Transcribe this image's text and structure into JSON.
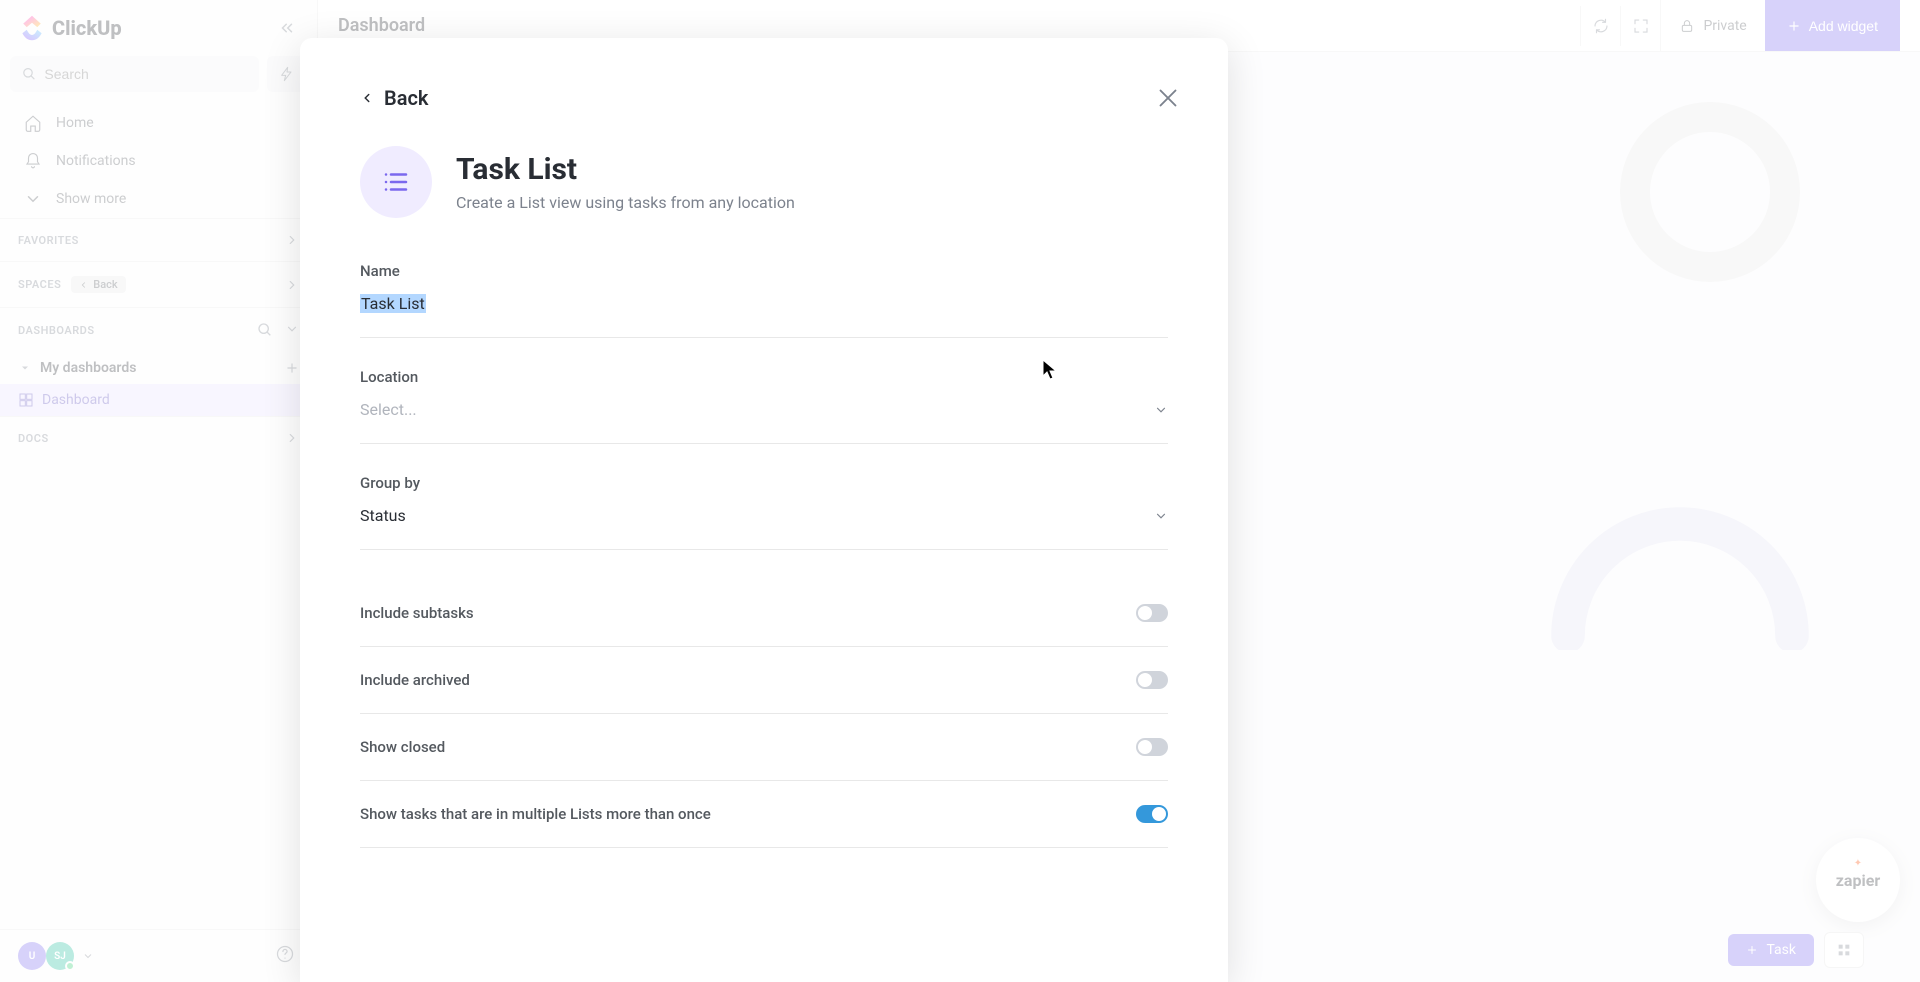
{
  "app": {
    "name": "ClickUp"
  },
  "sidebar": {
    "search_placeholder": "Search",
    "nav": {
      "home": "Home",
      "notifications": "Notifications",
      "show_more": "Show more"
    },
    "favorites_label": "FAVORITES",
    "spaces_label": "SPACES",
    "back_pill": "Back",
    "dashboards_label": "DASHBOARDS",
    "my_dashboards": "My dashboards",
    "dashboard_item": "Dashboard",
    "docs_label": "DOCS",
    "avatars": {
      "u": "U",
      "sj": "SJ"
    }
  },
  "topbar": {
    "title": "Dashboard",
    "private": "Private",
    "add_widget": "Add widget"
  },
  "modal": {
    "back": "Back",
    "title": "Task List",
    "description": "Create a List view using tasks from any location",
    "name_label": "Name",
    "name_value": "Task List",
    "location_label": "Location",
    "location_placeholder": "Select...",
    "groupby_label": "Group by",
    "groupby_value": "Status",
    "include_subtasks": "Include subtasks",
    "include_archived": "Include archived",
    "show_closed": "Show closed",
    "show_multi_lists": "Show tasks that are in multiple Lists more than once",
    "toggles": {
      "subtasks": false,
      "archived": false,
      "closed": false,
      "multi": true
    }
  },
  "fab": {
    "task": "Task"
  },
  "zapier": {
    "label": "zapier"
  }
}
